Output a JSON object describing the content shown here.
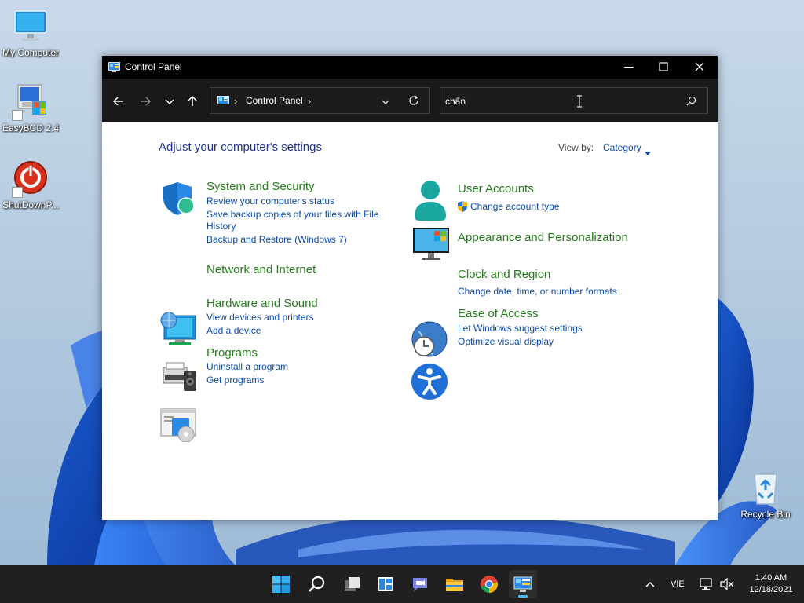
{
  "desktop": {
    "icons": [
      {
        "label": "My Computer"
      },
      {
        "label": "EasyBCD 2.4"
      },
      {
        "label": "ShutDownP..."
      },
      {
        "label": "Recycle Bin"
      }
    ]
  },
  "window": {
    "title": "Control Panel",
    "address": {
      "separator": "›",
      "crumb": "Control Panel"
    },
    "search": {
      "value": "chẩn"
    },
    "content": {
      "heading": "Adjust your computer's settings",
      "view_by_label": "View by:",
      "view_by_value": "Category",
      "categories": [
        {
          "title": "System and Security",
          "links": [
            "Review your computer's status",
            "Save backup copies of your files with File",
            "History",
            "Backup and Restore (Windows 7)"
          ]
        },
        {
          "title": "Network and Internet",
          "links": []
        },
        {
          "title": "Hardware and Sound",
          "links": [
            "View devices and printers",
            "Add a device"
          ]
        },
        {
          "title": "Programs",
          "links": [
            "Uninstall a program",
            "Get programs"
          ]
        },
        {
          "title": "User Accounts",
          "links": [
            "Change account type"
          ]
        },
        {
          "title": "Appearance and Personalization",
          "links": []
        },
        {
          "title": "Clock and Region",
          "links": [
            "Change date, time, or number formats"
          ]
        },
        {
          "title": "Ease of Access",
          "links": [
            "Let Windows suggest settings",
            "Optimize visual display"
          ]
        }
      ]
    }
  },
  "taskbar": {
    "apps": [
      "start-icon",
      "search-icon",
      "task-view-icon",
      "widgets-icon",
      "teams-chat-icon",
      "file-explorer-icon",
      "chrome-icon",
      "control-panel-icon"
    ],
    "tray": {
      "language": "VIE",
      "time": "1:40 AM",
      "date": "12/18/2021"
    }
  },
  "colors": {
    "link": "#0a49a7",
    "category_title": "#267b1d",
    "heading": "#1e3287",
    "accent": "#4cc2ff"
  }
}
